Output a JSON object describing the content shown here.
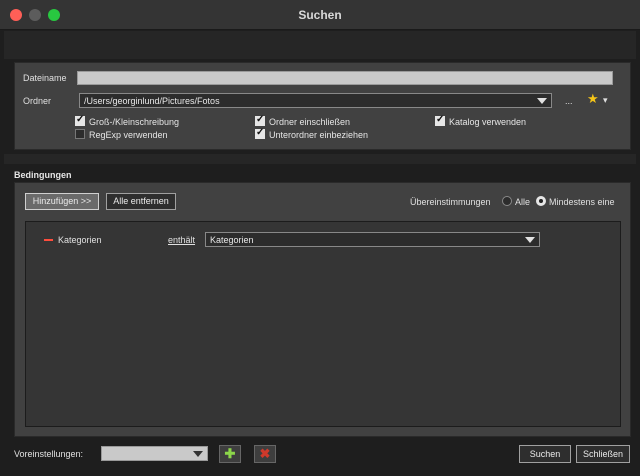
{
  "window": {
    "title": "Suchen"
  },
  "search": {
    "filename_label": "Dateiname",
    "filename_value": "",
    "folder_label": "Ordner",
    "folder_value": "/Users/georginlund/Pictures/Fotos",
    "browse_label": "...",
    "options": {
      "case_sensitive": {
        "label": "Groß-/Kleinschreibung",
        "checked": true
      },
      "regexp": {
        "label": "RegExp verwenden",
        "checked": false
      },
      "include_folders": {
        "label": "Ordner einschließen",
        "checked": true
      },
      "include_subfolders": {
        "label": "Unterordner einbeziehen",
        "checked": true
      },
      "use_catalog": {
        "label": "Katalog verwenden",
        "checked": true
      }
    }
  },
  "conditions": {
    "section_title": "Bedingungen",
    "add_button": "Hinzufügen >>",
    "remove_all_button": "Alle entfernen",
    "match_label": "Übereinstimmungen",
    "match_all_label": "Alle",
    "match_any_label": "Mindestens eine",
    "match_selected": "any",
    "rows": [
      {
        "field": "Kategorien",
        "operator": "enthält",
        "value": "Kategorien"
      }
    ]
  },
  "footer": {
    "presets_label": "Voreinstellungen:",
    "presets_value": "",
    "search_button": "Suchen",
    "close_button": "Schließen"
  },
  "icons": {
    "favorite": "star-icon",
    "favorite_color": "#f5c518",
    "add": "plus-icon",
    "add_color": "#8cd64a",
    "delete": "x-icon",
    "delete_color": "#d0392b",
    "remove_condition_color": "#ff4d3d"
  }
}
